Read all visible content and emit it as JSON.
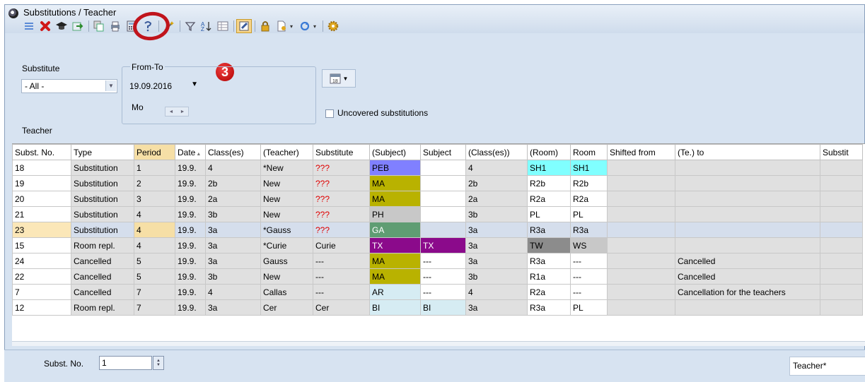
{
  "window": {
    "title": "Substitutions / Teacher"
  },
  "toolbar": {
    "icons": [
      "list-icon",
      "delete-icon",
      "graduation-cap-icon",
      "export-icon",
      "copy-icon",
      "print-icon",
      "calculator-icon",
      "help-icon",
      "wand-icon",
      "filter-icon",
      "sort-icon",
      "table-settings-icon",
      "pencil-check-icon",
      "lock-icon",
      "document-dropdown-icon",
      "refresh-dropdown-icon",
      "gear-icon"
    ]
  },
  "annotation": {
    "step": "3"
  },
  "filters": {
    "substitute_label": "Substitute",
    "substitute_value": "- All -",
    "from_to_label": "From-To",
    "date_value": "19.09.2016",
    "weekday": "Mo",
    "uncovered_label": "Uncovered substitutions",
    "uncovered_checked": false,
    "teacher_label": "Teacher"
  },
  "grid": {
    "columns": [
      "Subst. No.",
      "Type",
      "Period",
      "Date",
      "Class(es)",
      "(Teacher)",
      "Substitute",
      "(Subject)",
      "Subject",
      "(Class(es))",
      "(Room)",
      "Room",
      "Shifted from",
      "(Te.) to",
      "Substit"
    ],
    "rows": [
      [
        "18",
        "Substitution",
        "1",
        "19.9.",
        "4",
        "*New",
        "???",
        "PEB",
        "",
        "4",
        "SH1",
        "SH1",
        "",
        ""
      ],
      [
        "19",
        "Substitution",
        "2",
        "19.9.",
        "2b",
        "New",
        "???",
        "MA",
        "",
        "2b",
        "R2b",
        "R2b",
        "",
        ""
      ],
      [
        "20",
        "Substitution",
        "3",
        "19.9.",
        "2a",
        "New",
        "???",
        "MA",
        "",
        "2a",
        "R2a",
        "R2a",
        "",
        ""
      ],
      [
        "21",
        "Substitution",
        "4",
        "19.9.",
        "3b",
        "New",
        "???",
        "PH",
        "",
        "3b",
        "PL",
        "PL",
        "",
        ""
      ],
      [
        "23",
        "Substitution",
        "4",
        "19.9.",
        "3a",
        "*Gauss",
        "???",
        "GA",
        "",
        "3a",
        "R3a",
        "R3a",
        "",
        ""
      ],
      [
        "15",
        "Room repl.",
        "4",
        "19.9.",
        "3a",
        "*Curie",
        "Curie",
        "TX",
        "TX",
        "3a",
        "TW",
        "WS",
        "",
        ""
      ],
      [
        "24",
        "Cancelled",
        "5",
        "19.9.",
        "3a",
        "Gauss",
        "---",
        "MA",
        "---",
        "3a",
        "R3a",
        "---",
        "",
        "Cancelled"
      ],
      [
        "22",
        "Cancelled",
        "5",
        "19.9.",
        "3b",
        "New",
        "---",
        "MA",
        "---",
        "3b",
        "R1a",
        "---",
        "",
        "Cancelled"
      ],
      [
        "7",
        "Cancelled",
        "7",
        "19.9.",
        "4",
        "Callas",
        "---",
        "AR",
        "---",
        "4",
        "R2a",
        "---",
        "",
        "Cancellation for the teachers"
      ],
      [
        "12",
        "Room repl.",
        "7",
        "19.9.",
        "3a",
        "Cer",
        "Cer",
        "BI",
        "BI",
        "3a",
        "R3a",
        "PL",
        "",
        ""
      ]
    ],
    "selected_row": 4,
    "subject_colors": {
      "PEB": "#8080ff",
      "MA": "#b9b200",
      "PH": "#c8c8c8",
      "GA": "#5f9d73",
      "TX": "#8b0a8b",
      "AR": "#d6ecf3",
      "BI": "#d6ecf3"
    },
    "room_colors": {
      "SH1": "#80ffff",
      "TW": "#8c8c8c",
      "WS": "#c8c8c8"
    }
  },
  "status": {
    "subst_no_label": "Subst. No.",
    "subst_no_value": "1",
    "layout_name": "Teacher*"
  },
  "colors": {
    "accent_ring": "#c0141c",
    "panel_bg": "#d7e3f1"
  }
}
